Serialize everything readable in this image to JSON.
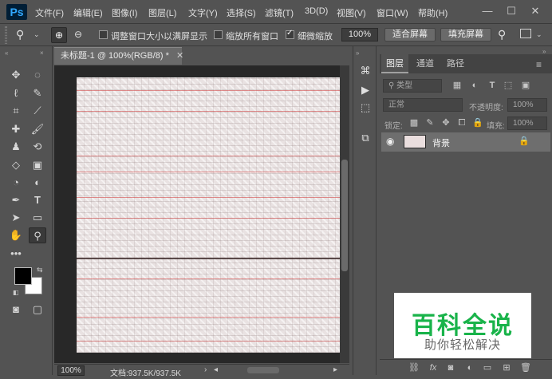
{
  "app": {
    "logo": "Ps"
  },
  "menu": [
    "文件(F)",
    "编辑(E)",
    "图像(I)",
    "图层(L)",
    "文字(Y)",
    "选择(S)",
    "滤镜(T)",
    "3D(D)",
    "视图(V)",
    "窗口(W)",
    "帮助(H)"
  ],
  "window_controls": {
    "minimize": "—",
    "maximize": "☐",
    "close": "✕"
  },
  "options": {
    "resize_windows_label": "调整窗口大小以满屏显示",
    "resize_windows_checked": false,
    "zoom_all_label": "缩放所有窗口",
    "zoom_all_checked": false,
    "scrubby_zoom_label": "细微缩放",
    "scrubby_zoom_checked": true,
    "zoom_value": "100%",
    "fit_screen_label": "适合屏幕",
    "fill_screen_label": "填充屏幕"
  },
  "document": {
    "tab_title": "未标题-1 @ 100%(RGB/8) *",
    "tab_close": "✕",
    "status_zoom": "100%",
    "status_doc": "文档:937.5K/937.5K"
  },
  "layers_panel": {
    "tabs": [
      "图层",
      "通道",
      "路径"
    ],
    "active_tab": "图层",
    "filter_kind": "类型",
    "blend_mode": "正常",
    "opacity_label": "不透明度:",
    "opacity_value": "100%",
    "lock_label": "锁定:",
    "fill_label": "填充:",
    "fill_value": "100%",
    "layers": [
      {
        "name": "背景",
        "visible": true,
        "locked": true
      }
    ]
  },
  "watermark": {
    "title": "百科全说",
    "subtitle": "助你轻松解决"
  },
  "colors": {
    "chrome": "#535353",
    "canvas_bg": "#282828",
    "document_fill": "#e9e2e2",
    "foreground": "#000000",
    "background": "#ffffff",
    "watermark_green": "#19b34a"
  },
  "icons": {
    "tools": [
      "move-icon",
      "marquee-icon",
      "lasso-icon",
      "quick-select-icon",
      "crop-icon",
      "eyedropper-icon",
      "healing-icon",
      "brush-icon",
      "stamp-icon",
      "history-brush-icon",
      "eraser-icon",
      "gradient-icon",
      "blur-icon",
      "dodge-icon",
      "pen-icon",
      "type-icon",
      "path-select-icon",
      "rectangle-icon",
      "hand-icon",
      "zoom-icon",
      "more-tools-icon",
      "swap-colors-icon",
      "default-colors-icon",
      "quick-mask-icon",
      "screen-mode-icon"
    ]
  }
}
